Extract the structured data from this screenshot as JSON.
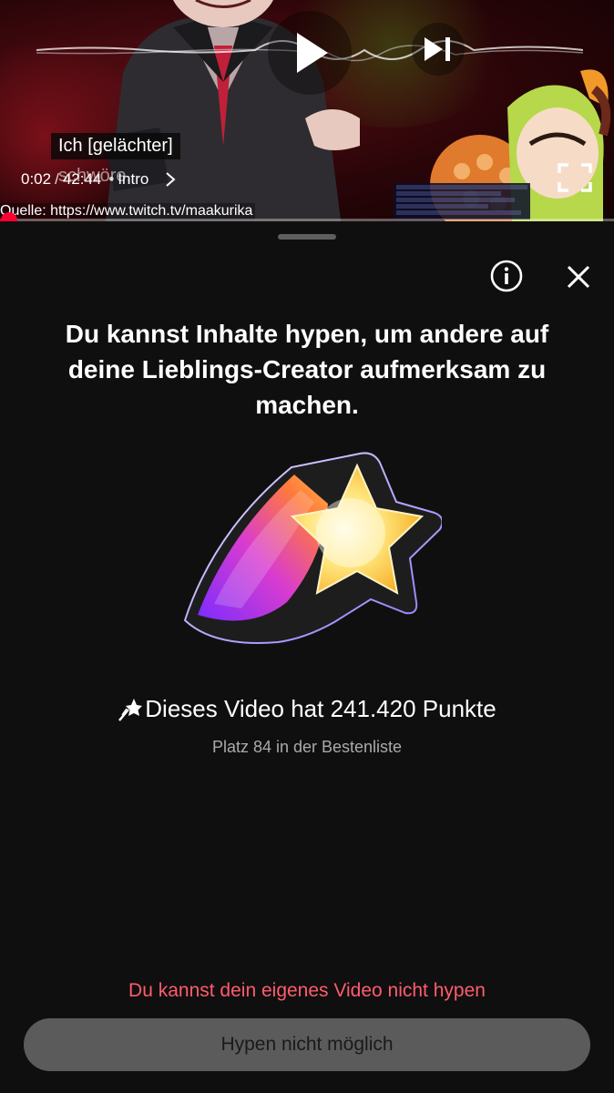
{
  "player": {
    "caption_line1": "Ich [gelächter]",
    "caption_line2": "schwöre,",
    "current_time": "0:02",
    "time_separator": "/",
    "duration": "42:44",
    "chapter_separator": "•",
    "chapter": "Intro",
    "source_text": "Quelle: https://www.twitch.tv/maakurika",
    "progress_fraction": 0.002,
    "accent_color": "#ff0033",
    "icons": {
      "play": "play-icon",
      "next": "skip-next-icon",
      "fullscreen": "fullscreen-icon",
      "chapter_chevron": "chevron-right-icon"
    }
  },
  "sheet": {
    "headline": "Du kannst Inhalte hypen, um andere auf deine Lieblings-Creator aufmerksam zu machen.",
    "points_text": "Dieses Video hat 241.420 Punkte",
    "rank_text": "Platz 84 in der Bestenliste",
    "warning_text": "Du kannst dein eigenes Video nicht hypen",
    "button_label": "Hypen nicht möglich",
    "warning_color": "#ff5c6e",
    "icons": {
      "info": "info-icon",
      "close": "close-icon",
      "points": "hype-star-icon",
      "illustration": "shooting-star-icon"
    }
  }
}
